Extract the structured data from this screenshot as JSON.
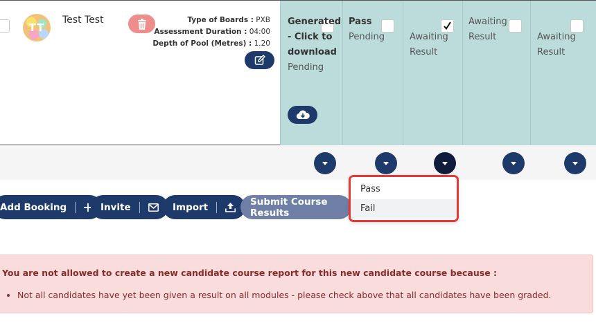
{
  "candidate": {
    "name": "Test Test",
    "avatar_initials": "TT",
    "details": [
      {
        "label": "Type of Boards :",
        "value": "PXB"
      },
      {
        "label": "Assessment Duration :",
        "value": "04:00"
      },
      {
        "label": "Depth of Pool (Metres) :",
        "value": "1.20"
      }
    ]
  },
  "modules": [
    {
      "title": "Generated - Click to download",
      "status": "Pending",
      "checked": false
    },
    {
      "title": "Pass",
      "status": "Pending",
      "checked": false
    },
    {
      "title": "",
      "status": "Awaiting Result",
      "checked": true
    },
    {
      "title": "",
      "status": "Awaiting Result",
      "checked": false
    },
    {
      "title": "",
      "status": "Awaiting Result",
      "checked": false
    }
  ],
  "dropdown_menu": {
    "items": [
      "Pass",
      "Fail"
    ],
    "hovered": "Fail"
  },
  "actions": {
    "add_booking": "Add Booking",
    "invite": "Invite",
    "import": "Import",
    "submit_course_results": "Submit Course Results"
  },
  "alert": {
    "title": "You are not allowed to create a new candidate course report for this new candidate course because :",
    "items": [
      "Not all candidates have yet been given a result on all modules - please check above that all candidates have been graded."
    ]
  },
  "colors": {
    "primary": "#1e3a6b",
    "module_bg": "#bcdcdb",
    "delete": "#ef8c8c",
    "alert_bg": "#f9dcdc",
    "alert_text": "#8a2a2a",
    "highlight_border": "#e53935"
  },
  "icons": {
    "delete": "trash-icon",
    "edit": "edit-icon",
    "download": "cloud-download-icon",
    "add": "plus-icon",
    "invite": "envelope-icon",
    "import": "upload-icon",
    "dropdown": "caret-down-icon"
  }
}
